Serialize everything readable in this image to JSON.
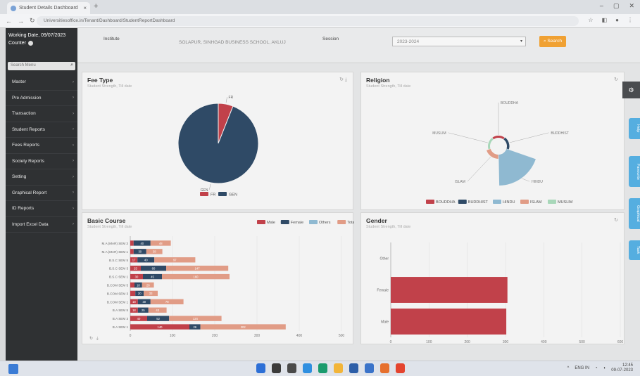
{
  "browser": {
    "tab_title": "Student Details Dashboard",
    "url": "Universitiesoffice.in/Tenant/Dashboard/StudentReportDashboard",
    "icons": [
      "back-icon",
      "forward-icon",
      "reload-icon",
      "bookmark-icon",
      "extensions-icon",
      "menu-icon"
    ]
  },
  "sidebar": {
    "working_date": "Working Date, 09/07/2023",
    "user": "Counter",
    "search_placeholder": "Search Menu",
    "items": [
      {
        "label": "Master"
      },
      {
        "label": "Pre Admission"
      },
      {
        "label": "Transaction"
      },
      {
        "label": "Student Reports"
      },
      {
        "label": "Fees Reports"
      },
      {
        "label": "Society Reports"
      },
      {
        "label": "Setting"
      },
      {
        "label": "Graphical Report"
      },
      {
        "label": "ID Reports"
      },
      {
        "label": "Import Excel Data"
      }
    ]
  },
  "filters": {
    "institute_label": "Institute",
    "institute_value": "SOLAPUR, SINHGAD BUSINESS SCHOOL, AKLUJ",
    "session_label": "Session",
    "session_value": "2023-2024",
    "search_label": "Search"
  },
  "panels": {
    "fee_type": {
      "title": "Fee Type",
      "subtitle": "Student Strength, Till date"
    },
    "religion": {
      "title": "Religion",
      "subtitle": "Student Strength, Till date"
    },
    "basic_course": {
      "title": "Basic Course",
      "subtitle": "Student Strength, Till date"
    },
    "gender": {
      "title": "Gender",
      "subtitle": "Student Strength, Till date"
    }
  },
  "right_tabs": [
    "Help",
    "Favourite",
    "Graphical",
    "Task"
  ],
  "colors": {
    "red": "#c1414a",
    "navy": "#2f4a66",
    "lightblue": "#8fb9d1",
    "salmon": "#e19c86",
    "green": "#a8d7b9",
    "accent_orange": "#f0a133"
  },
  "chart_data": [
    {
      "type": "pie",
      "title": "Fee Type",
      "labels": [
        "FR",
        "GEN"
      ],
      "values": [
        6,
        94
      ],
      "legend": [
        "FR",
        "GEN"
      ],
      "colors": [
        "#c1414a",
        "#2f4a66"
      ]
    },
    {
      "type": "pie",
      "title": "Religion",
      "labels": [
        "MUSLIM",
        "BOUDDHA",
        "BUDDHIST",
        "HINDU",
        "ISLAM"
      ],
      "legend": [
        "BOUDDHA",
        "BUDDHIST",
        "HINDU",
        "ISLAM",
        "MUSLIM"
      ],
      "values": [
        2,
        2,
        3,
        85,
        8
      ],
      "colors": [
        "#a8d7b9",
        "#c1414a",
        "#2f4a66",
        "#8fb9d1",
        "#e19c86"
      ]
    },
    {
      "type": "bar",
      "title": "Basic Course",
      "categories": [
        "M.A (MAR) SEM 3",
        "M.A (MAR) SEM 1",
        "B.S.C SEM 5",
        "B.S.C SEM 3",
        "B.S.C SEM 1",
        "B.COM SEM 5",
        "B.COM SEM 3",
        "B.COM SEM 1",
        "B.A SEM 5",
        "B.A SEM 3",
        "B.A SEM 1"
      ],
      "series": [
        {
          "name": "Male",
          "values": [
            8,
            8,
            17,
            25,
            30,
            10,
            12,
            18,
            18,
            40,
            140
          ]
        },
        {
          "name": "Female",
          "values": [
            40,
            30,
            40,
            60,
            45,
            18,
            20,
            30,
            25,
            52,
            26
          ]
        },
        {
          "name": "Others",
          "values": [
            0,
            0,
            0,
            0,
            0,
            0,
            0,
            0,
            0,
            0,
            0
          ]
        },
        {
          "name": "Total",
          "values": [
            48,
            38,
            97,
            147,
            160,
            28,
            33,
            78,
            43,
            124,
            202
          ]
        }
      ],
      "xlim": [
        0,
        500
      ],
      "xticks": [
        0,
        100,
        200,
        300,
        400,
        500
      ],
      "legend": [
        "Male",
        "Female",
        "Others",
        "Total"
      ]
    },
    {
      "type": "bar",
      "title": "Gender",
      "categories": [
        "Other",
        "Female",
        "Male"
      ],
      "values": [
        0,
        305,
        302
      ],
      "xlim": [
        0,
        600
      ],
      "xticks": [
        0,
        100,
        200,
        300,
        400,
        500,
        600
      ]
    }
  ],
  "taskbar": {
    "lang": "ENG IN",
    "time": "12:45",
    "date": "09-07-2023"
  }
}
